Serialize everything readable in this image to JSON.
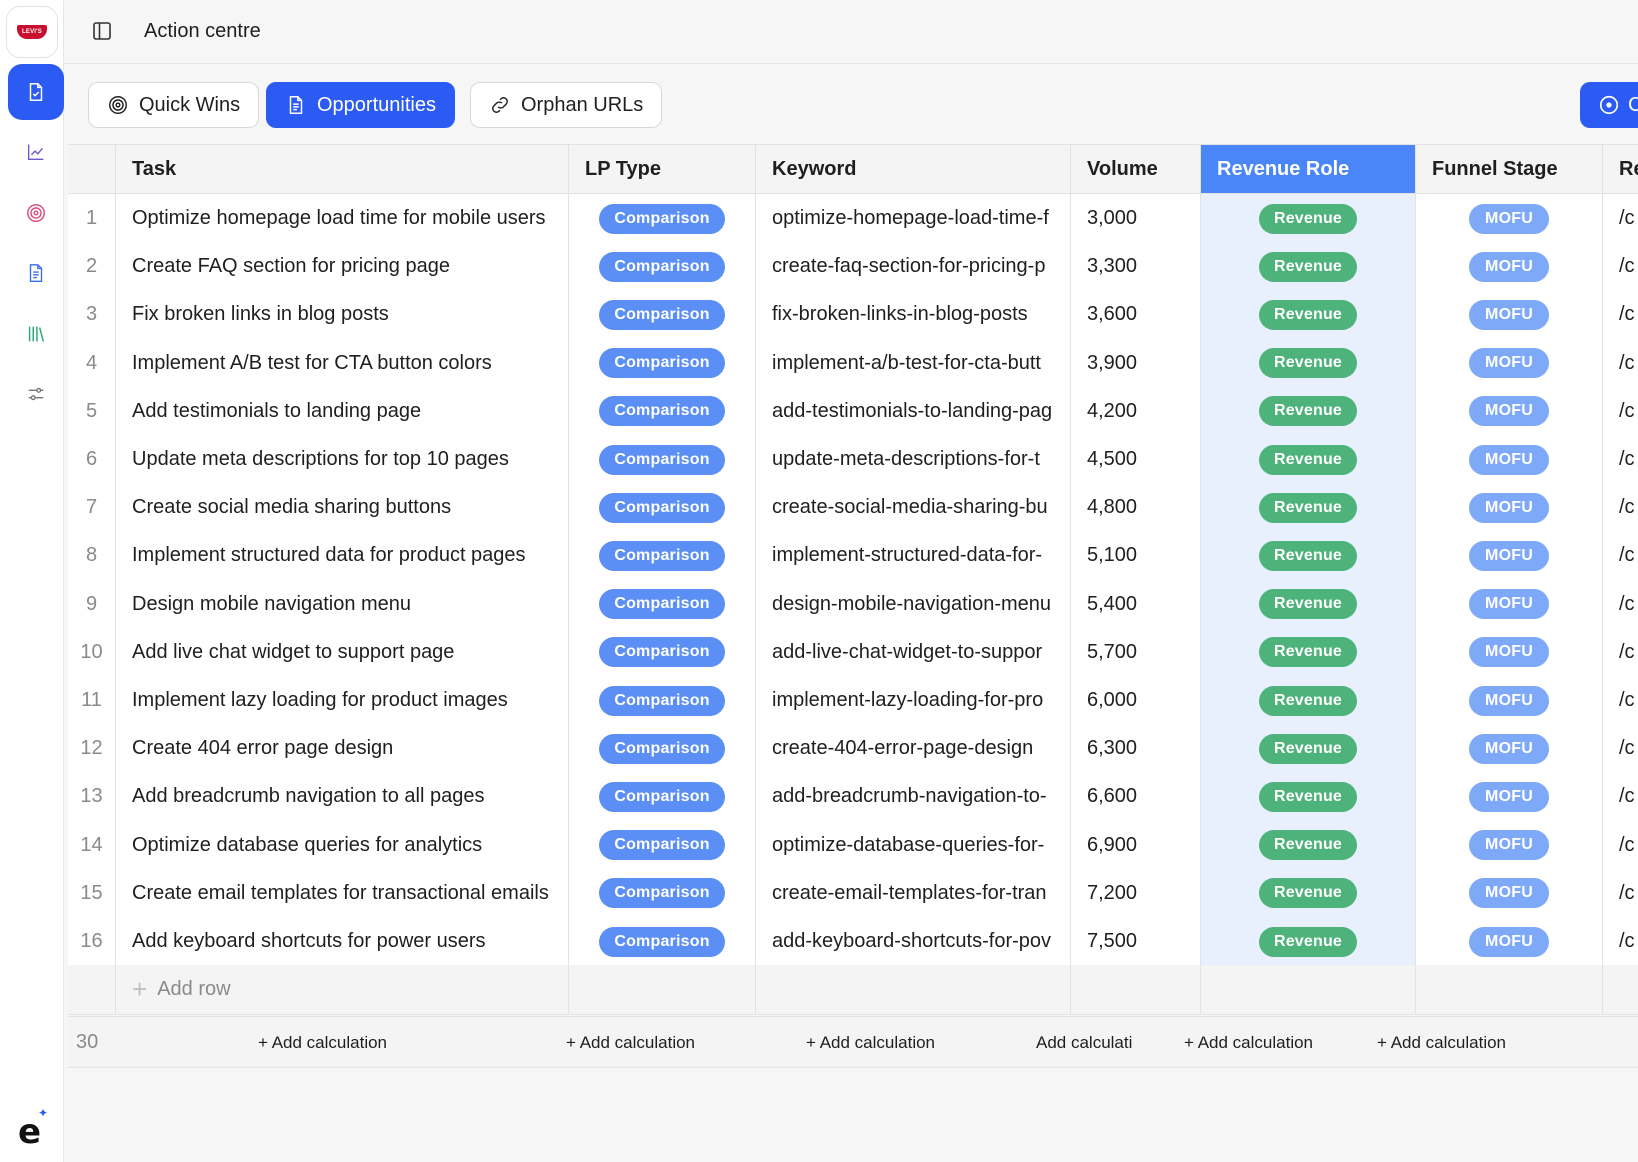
{
  "header": {
    "title": "Action centre"
  },
  "brand": {
    "logo_text": "LEVI'S",
    "mark": "e"
  },
  "sidebar": {
    "items": [
      {
        "icon": "document-sparkle-icon",
        "active": true
      },
      {
        "icon": "chart-line-icon",
        "active": false
      },
      {
        "icon": "target-icon",
        "active": false
      },
      {
        "icon": "document-icon",
        "active": false
      },
      {
        "icon": "library-icon",
        "active": false
      },
      {
        "icon": "sliders-icon",
        "active": false
      }
    ]
  },
  "tabs": [
    {
      "label": "Quick Wins",
      "icon": "target-icon",
      "active": false
    },
    {
      "label": "Opportunities",
      "icon": "document-icon",
      "active": true
    },
    {
      "label": "Orphan URLs",
      "icon": "link-icon",
      "active": false
    }
  ],
  "right_button": {
    "label": "C",
    "icon": "circle-dot-icon"
  },
  "table": {
    "columns": [
      "Task",
      "LP Type",
      "Keyword",
      "Volume",
      "Revenue Role",
      "Funnel Stage",
      "Re"
    ],
    "rows": [
      {
        "n": "1",
        "task": "Optimize homepage load time for mobile users",
        "lp": "Comparison",
        "keyword": "optimize-homepage-load-time-f",
        "volume": "3,000",
        "role": "Revenue",
        "stage": "MOFU",
        "re": "/c"
      },
      {
        "n": "2",
        "task": "Create FAQ section for pricing page",
        "lp": "Comparison",
        "keyword": "create-faq-section-for-pricing-p",
        "volume": "3,300",
        "role": "Revenue",
        "stage": "MOFU",
        "re": "/c"
      },
      {
        "n": "3",
        "task": "Fix broken links in blog posts",
        "lp": "Comparison",
        "keyword": "fix-broken-links-in-blog-posts",
        "volume": "3,600",
        "role": "Revenue",
        "stage": "MOFU",
        "re": "/c"
      },
      {
        "n": "4",
        "task": "Implement A/B test for CTA button colors",
        "lp": "Comparison",
        "keyword": "implement-a/b-test-for-cta-butt",
        "volume": "3,900",
        "role": "Revenue",
        "stage": "MOFU",
        "re": "/c"
      },
      {
        "n": "5",
        "task": "Add testimonials to landing page",
        "lp": "Comparison",
        "keyword": "add-testimonials-to-landing-pag",
        "volume": "4,200",
        "role": "Revenue",
        "stage": "MOFU",
        "re": "/c"
      },
      {
        "n": "6",
        "task": "Update meta descriptions for top 10 pages",
        "lp": "Comparison",
        "keyword": "update-meta-descriptions-for-t",
        "volume": "4,500",
        "role": "Revenue",
        "stage": "MOFU",
        "re": "/c"
      },
      {
        "n": "7",
        "task": "Create social media sharing buttons",
        "lp": "Comparison",
        "keyword": "create-social-media-sharing-bu",
        "volume": "4,800",
        "role": "Revenue",
        "stage": "MOFU",
        "re": "/c"
      },
      {
        "n": "8",
        "task": "Implement structured data for product pages",
        "lp": "Comparison",
        "keyword": "implement-structured-data-for-",
        "volume": "5,100",
        "role": "Revenue",
        "stage": "MOFU",
        "re": "/c"
      },
      {
        "n": "9",
        "task": "Design mobile navigation menu",
        "lp": "Comparison",
        "keyword": "design-mobile-navigation-menu",
        "volume": "5,400",
        "role": "Revenue",
        "stage": "MOFU",
        "re": "/c"
      },
      {
        "n": "10",
        "task": "Add live chat widget to support page",
        "lp": "Comparison",
        "keyword": "add-live-chat-widget-to-suppor",
        "volume": "5,700",
        "role": "Revenue",
        "stage": "MOFU",
        "re": "/c"
      },
      {
        "n": "11",
        "task": "Implement lazy loading for product images",
        "lp": "Comparison",
        "keyword": "implement-lazy-loading-for-pro",
        "volume": "6,000",
        "role": "Revenue",
        "stage": "MOFU",
        "re": "/c"
      },
      {
        "n": "12",
        "task": "Create 404 error page design",
        "lp": "Comparison",
        "keyword": "create-404-error-page-design",
        "volume": "6,300",
        "role": "Revenue",
        "stage": "MOFU",
        "re": "/c"
      },
      {
        "n": "13",
        "task": "Add breadcrumb navigation to all pages",
        "lp": "Comparison",
        "keyword": "add-breadcrumb-navigation-to-",
        "volume": "6,600",
        "role": "Revenue",
        "stage": "MOFU",
        "re": "/c"
      },
      {
        "n": "14",
        "task": "Optimize database queries for analytics",
        "lp": "Comparison",
        "keyword": "optimize-database-queries-for-",
        "volume": "6,900",
        "role": "Revenue",
        "stage": "MOFU",
        "re": "/c"
      },
      {
        "n": "15",
        "task": "Create email templates for transactional emails",
        "lp": "Comparison",
        "keyword": "create-email-templates-for-tran",
        "volume": "7,200",
        "role": "Revenue",
        "stage": "MOFU",
        "re": "/c"
      },
      {
        "n": "16",
        "task": "Add keyboard shortcuts for power users",
        "lp": "Comparison",
        "keyword": "add-keyboard-shortcuts-for-pov",
        "volume": "7,500",
        "role": "Revenue",
        "stage": "MOFU",
        "re": "/c"
      }
    ],
    "add_row_label": "Add row",
    "footer": {
      "count": "30",
      "calculations": [
        "+ Add calculation",
        "+ Add calculation",
        "+ Add calculation",
        "Add calculati",
        "+ Add calculation",
        "+ Add calculation"
      ]
    }
  },
  "colors": {
    "accent": "#2b5bf3",
    "highlight_header": "#4a86f7",
    "highlight_col": "#e8f0fd",
    "pill_blue": "#5b8ff5",
    "pill_green": "#4db37a"
  }
}
